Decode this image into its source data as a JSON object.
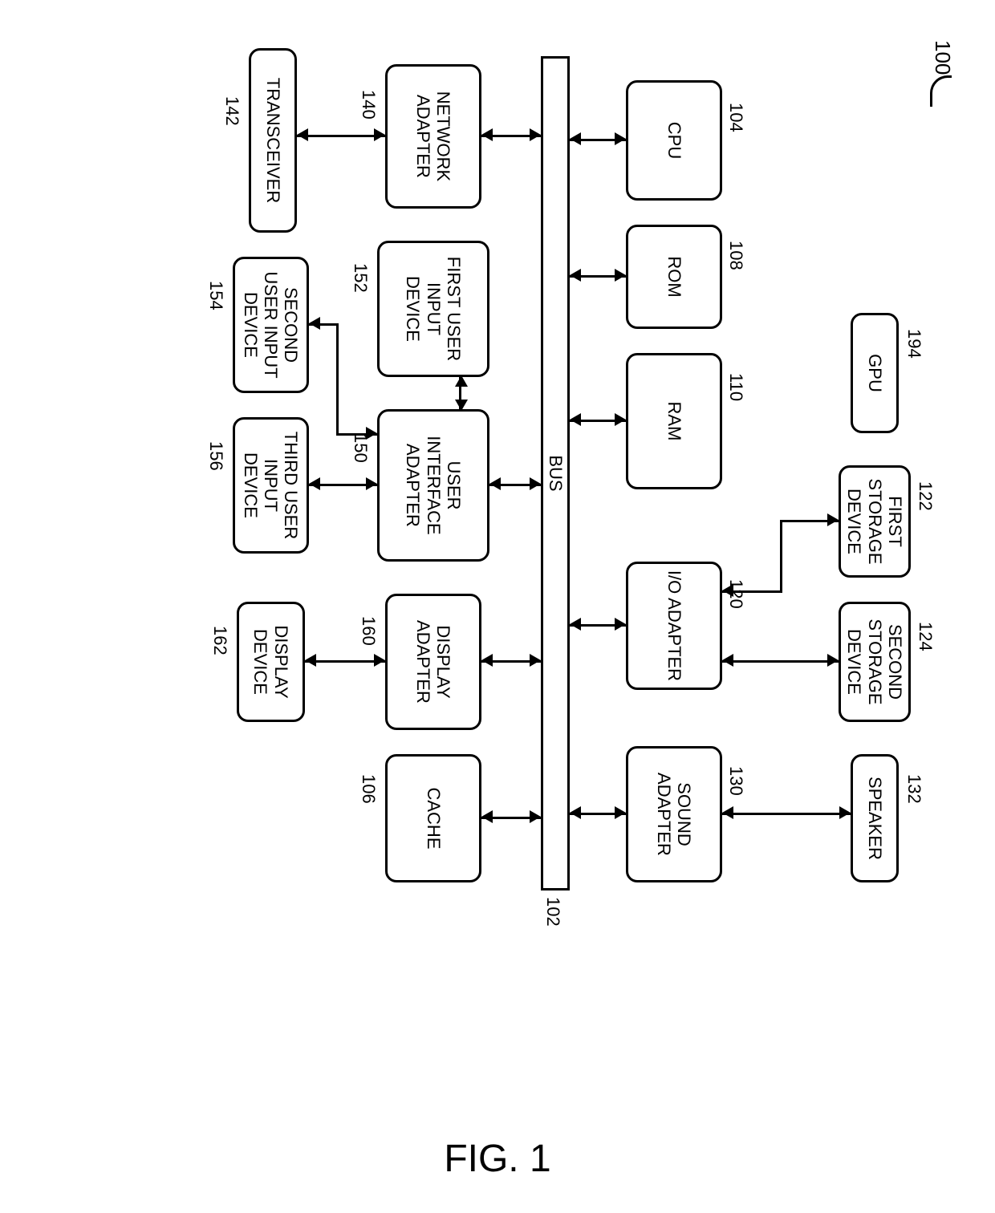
{
  "figure_label": "FIG. 1",
  "ref_100": "100",
  "bus": {
    "label": "BUS",
    "ref": "102"
  },
  "top_row": {
    "gpu": {
      "label": "GPU",
      "ref": "194"
    },
    "first_storage": {
      "label": "FIRST STORAGE DEVICE",
      "ref": "122"
    },
    "second_storage": {
      "label": "SECOND STORAGE DEVICE",
      "ref": "124"
    },
    "speaker": {
      "label": "SPEAKER",
      "ref": "132"
    }
  },
  "mid_top": {
    "cpu": {
      "label": "CPU",
      "ref": "104"
    },
    "rom": {
      "label": "ROM",
      "ref": "108"
    },
    "ram": {
      "label": "RAM",
      "ref": "110"
    },
    "io_adapter": {
      "label": "I/O ADAPTER",
      "ref": "120"
    },
    "sound_adapter": {
      "label": "SOUND ADAPTER",
      "ref": "130"
    }
  },
  "mid_bot": {
    "network_adapter": {
      "label": "NETWORK ADAPTER",
      "ref": "140"
    },
    "first_user_input": {
      "label": "FIRST USER INPUT DEVICE",
      "ref": "152"
    },
    "user_if_adapter": {
      "label": "USER INTERFACE ADAPTER",
      "ref": "150"
    },
    "display_adapter": {
      "label": "DISPLAY ADAPTER",
      "ref": "160"
    },
    "cache": {
      "label": "CACHE",
      "ref": "106"
    }
  },
  "bot_row": {
    "transceiver": {
      "label": "TRANSCEIVER",
      "ref": "142"
    },
    "second_user_input": {
      "label": "SECOND USER INPUT DEVICE",
      "ref": "154"
    },
    "third_user_input": {
      "label": "THIRD USER INPUT DEVICE",
      "ref": "156"
    },
    "display_device": {
      "label": "DISPLAY DEVICE",
      "ref": "162"
    }
  }
}
